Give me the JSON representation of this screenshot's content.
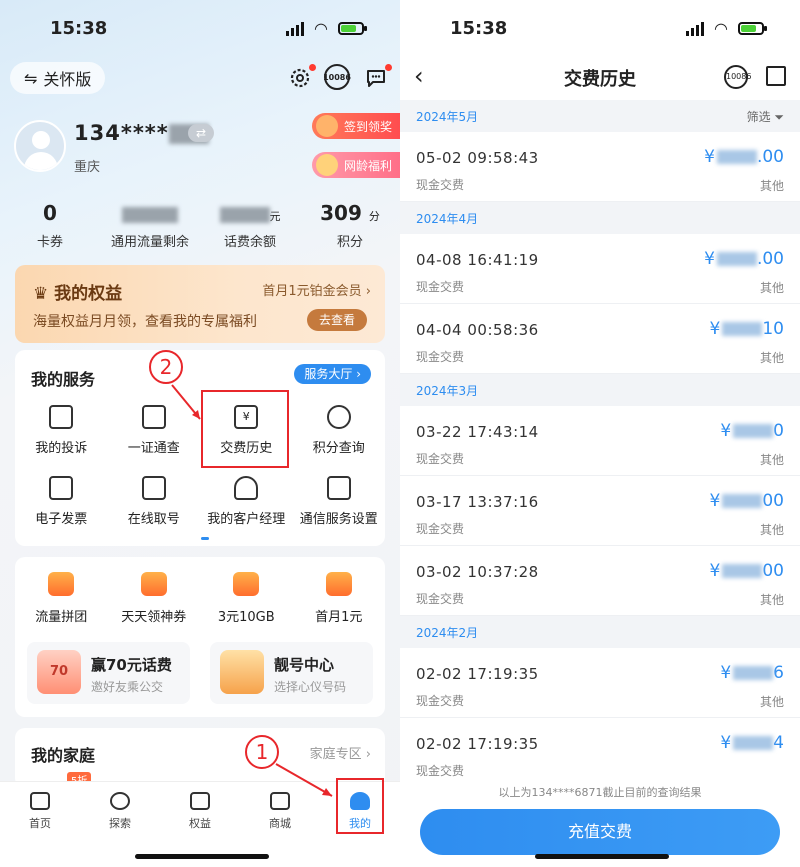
{
  "status": {
    "time": "15:38"
  },
  "left": {
    "care_mode": "关怀版",
    "phone": "134****",
    "city": "重庆",
    "signin_pill": "签到领奖",
    "network_pill": "网龄福利",
    "stats": [
      {
        "value": "0",
        "unit": "",
        "label": "卡券"
      },
      {
        "value": "",
        "unit": "",
        "label": "通用流量剩余"
      },
      {
        "value": "",
        "unit": "元",
        "label": "话费余额"
      },
      {
        "value": "309",
        "unit": "分",
        "label": "积分"
      }
    ],
    "rights": {
      "title": "我的权益",
      "member": "首月1元铂金会员",
      "subtitle": "海量权益月月领，查看我的专属福利",
      "button": "去查看"
    },
    "services": {
      "title": "我的服务",
      "hall": "服务大厅",
      "items": [
        "我的投诉",
        "一证通查",
        "交费历史",
        "积分查询",
        "电子发票",
        "在线取号",
        "我的客户经理",
        "通信服务设置"
      ]
    },
    "promo": {
      "items": [
        "流量拼团",
        "天天领神券",
        "3元10GB",
        "首月1元"
      ],
      "boxes": [
        {
          "title": "赢70元话费",
          "subtitle": "邀好友乘公交",
          "badge": "70"
        },
        {
          "title": "靓号中心",
          "subtitle": "选择心仪号码"
        }
      ]
    },
    "family": {
      "title": "我的家庭",
      "zone": "家庭专区",
      "tag": "5折"
    },
    "tabs": [
      "首页",
      "探索",
      "权益",
      "商城",
      "我的"
    ],
    "annotations": [
      "1",
      "2"
    ],
    "service_icon": "10086"
  },
  "right": {
    "title": "交费历史",
    "service_icon": "10086",
    "filter": "筛选",
    "months": [
      {
        "label": "2024年5月",
        "rows": [
          {
            "datetime": "05-02  09:58:43",
            "kind": "现金交费",
            "amount": ".00",
            "other": "其他"
          }
        ]
      },
      {
        "label": "2024年4月",
        "rows": [
          {
            "datetime": "04-08  16:41:19",
            "kind": "现金交费",
            "amount": ".00",
            "other": "其他"
          },
          {
            "datetime": "04-04  00:58:36",
            "kind": "现金交费",
            "amount": "10",
            "other": "其他"
          }
        ]
      },
      {
        "label": "2024年3月",
        "rows": [
          {
            "datetime": "03-22  17:43:14",
            "kind": "现金交费",
            "amount": "0",
            "other": "其他"
          },
          {
            "datetime": "03-17  13:37:16",
            "kind": "现金交费",
            "amount": "00",
            "other": "其他"
          },
          {
            "datetime": "03-02  10:37:28",
            "kind": "现金交费",
            "amount": "00",
            "other": "其他"
          }
        ]
      },
      {
        "label": "2024年2月",
        "rows": [
          {
            "datetime": "02-02  17:19:35",
            "kind": "现金交费",
            "amount": "6",
            "other": "其他"
          },
          {
            "datetime": "02-02  17:19:35",
            "kind": "现金交费",
            "amount": "4",
            "other": ""
          }
        ]
      }
    ],
    "note": "以上为134****6871截止目前的查询结果",
    "recharge": "充值交费"
  }
}
